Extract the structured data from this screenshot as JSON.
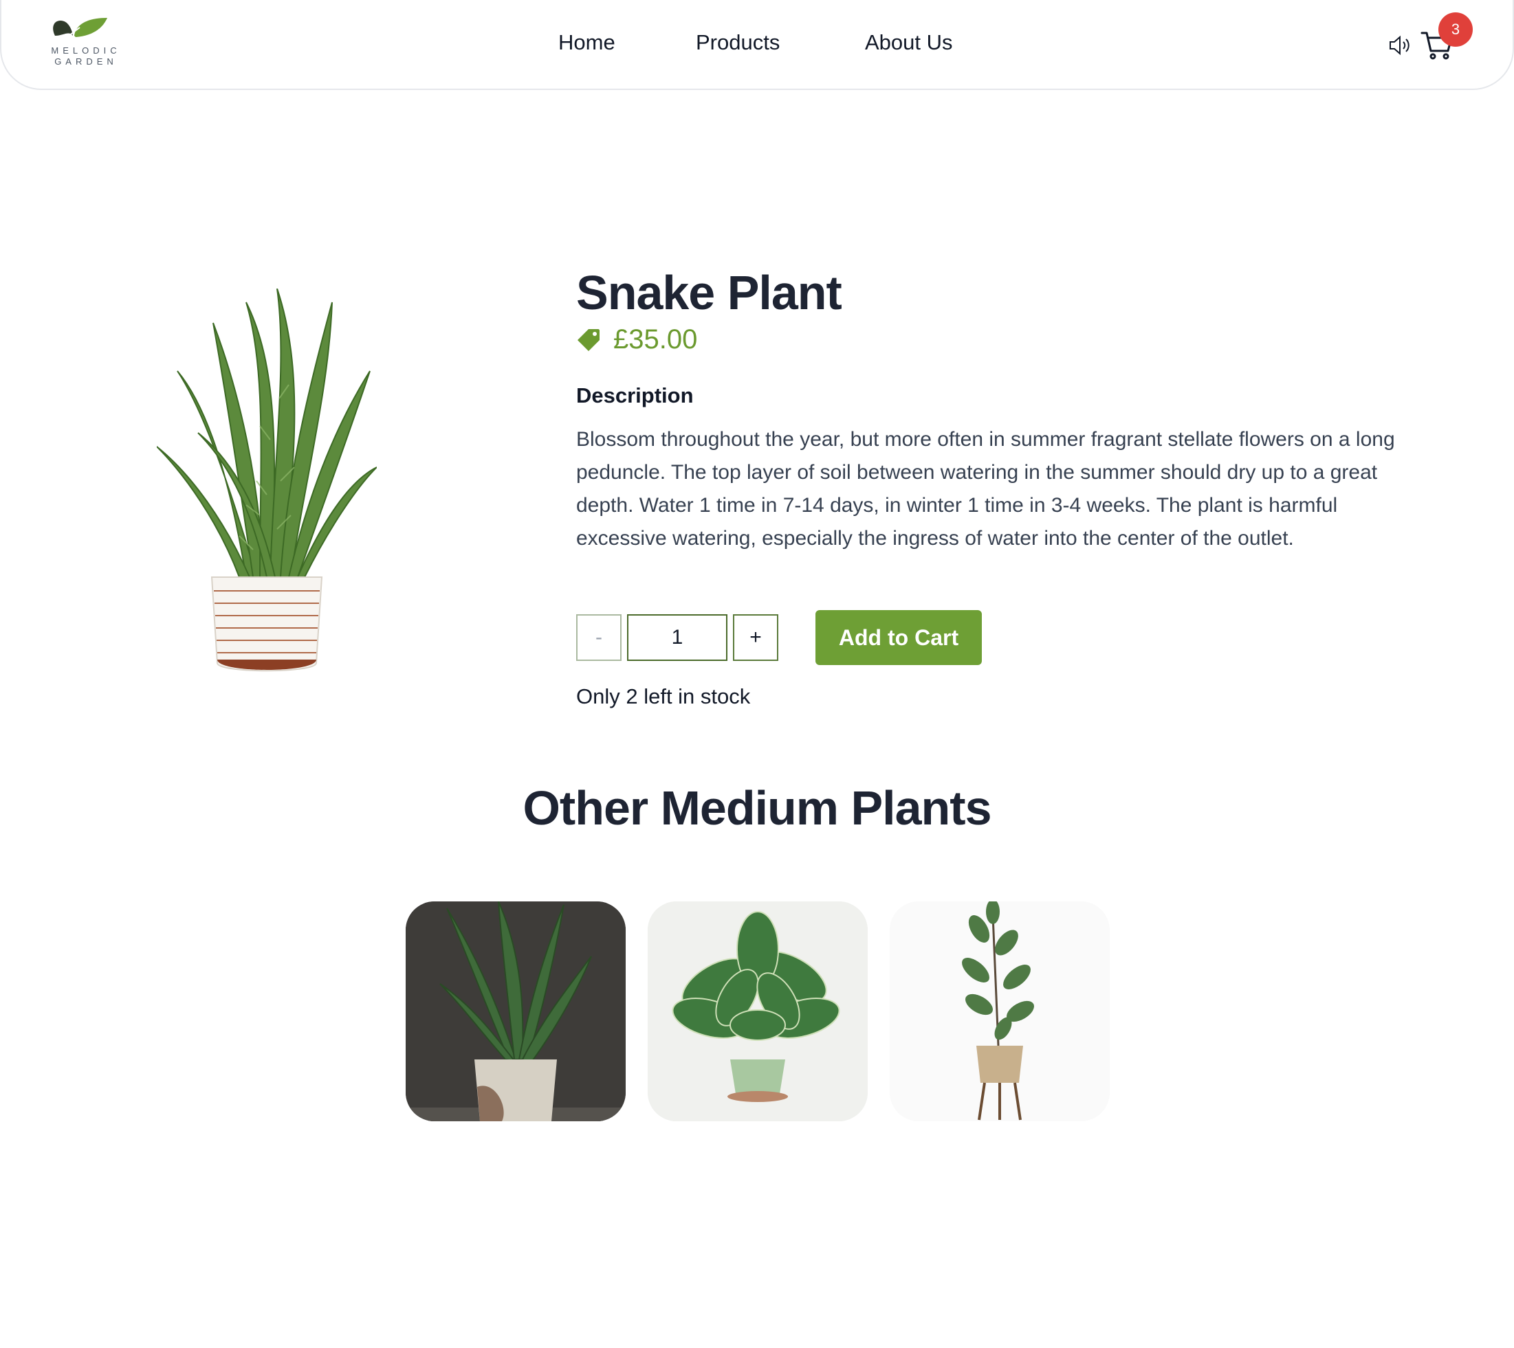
{
  "brand": {
    "name_line1": "MELODIC",
    "name_line2": "GARDEN"
  },
  "nav": {
    "items": [
      {
        "label": "Home"
      },
      {
        "label": "Products"
      },
      {
        "label": "About Us"
      }
    ]
  },
  "header_actions": {
    "speaker_icon": "speaker-icon",
    "cart_icon": "cart-icon",
    "cart_count": "3"
  },
  "product": {
    "title": "Snake Plant",
    "price": "£35.00",
    "description_heading": "Description",
    "description": "Blossom throughout the year, but more often in summer fragrant stellate flowers on a long peduncle. The top layer of soil between watering in the summer should dry up to a great depth. Water 1 time in 7-14 days, in winter 1 time in 3-4 weeks. The plant is harmful excessive watering, especially the ingress of water into the center of the outlet.",
    "quantity": "1",
    "minus_label": "-",
    "plus_label": "+",
    "add_to_cart_label": "Add to Cart",
    "stock_text": "Only 2 left in stock"
  },
  "related": {
    "title": "Other Medium Plants"
  },
  "colors": {
    "accent_green": "#6e9f35",
    "price_green": "#6b9a2f",
    "badge_red": "#e0403a",
    "heading": "#1e2433"
  }
}
